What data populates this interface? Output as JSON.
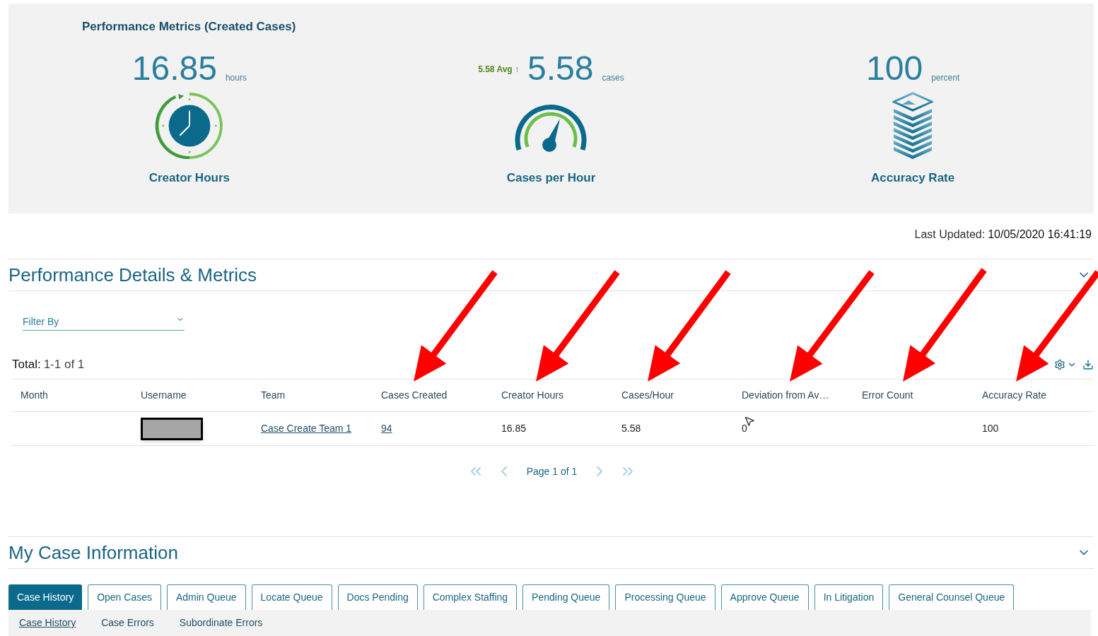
{
  "metrics_panel": {
    "title": "Performance Metrics (Created Cases)",
    "metrics": [
      {
        "kind": "clock",
        "value": "16.85",
        "unit": "hours",
        "label": "Creator Hours"
      },
      {
        "kind": "gauge",
        "avg": "5.58 Avg ↑",
        "value": "5.58",
        "unit": "cases",
        "label": "Cases per Hour"
      },
      {
        "kind": "stack",
        "value": "100",
        "unit": "percent",
        "label": "Accuracy Rate"
      }
    ]
  },
  "last_updated": {
    "label": "Last Updated:",
    "value": "10/05/2020 16:41:19"
  },
  "details_section": {
    "title": "Performance Details & Metrics",
    "expanded": true,
    "filter": {
      "placeholder": "Filter By"
    },
    "total": {
      "label": "Total:",
      "value": "1-1 of 1"
    },
    "table": {
      "columns": [
        "Month",
        "Username",
        "Team",
        "Cases Created",
        "Creator Hours",
        "Cases/Hour",
        "Deviation from Av…",
        "Error Count",
        "Accuracy Rate"
      ],
      "rows": [
        [
          {
            "kind": "empty"
          },
          {
            "kind": "redacted"
          },
          {
            "kind": "link",
            "text": "Case Create Team 1"
          },
          {
            "kind": "link",
            "text": "94"
          },
          {
            "kind": "text",
            "text": "16.85"
          },
          {
            "kind": "text",
            "text": "5.58"
          },
          {
            "kind": "text",
            "text": "0"
          },
          {
            "kind": "empty"
          },
          {
            "kind": "text",
            "text": "100"
          }
        ]
      ]
    },
    "pagination": {
      "text": "Page 1 of 1"
    }
  },
  "case_section": {
    "title": "My Case Information",
    "expanded": true,
    "tabs": [
      {
        "label": "Case History",
        "selected": true
      },
      {
        "label": "Open Cases",
        "selected": false
      },
      {
        "label": "Admin Queue",
        "selected": false
      },
      {
        "label": "Locate Queue",
        "selected": false
      },
      {
        "label": "Docs Pending",
        "selected": false
      },
      {
        "label": "Complex Staffing",
        "selected": false
      },
      {
        "label": "Pending Queue",
        "selected": false
      },
      {
        "label": "Processing Queue",
        "selected": false
      },
      {
        "label": "Approve Queue",
        "selected": false
      },
      {
        "label": "In Litigation",
        "selected": false
      },
      {
        "label": "General Counsel Queue",
        "selected": false
      }
    ],
    "subtabs": [
      {
        "label": "Case History",
        "selected": true
      },
      {
        "label": "Case Errors",
        "selected": false
      },
      {
        "label": "Subordinate Errors",
        "selected": false
      }
    ]
  }
}
